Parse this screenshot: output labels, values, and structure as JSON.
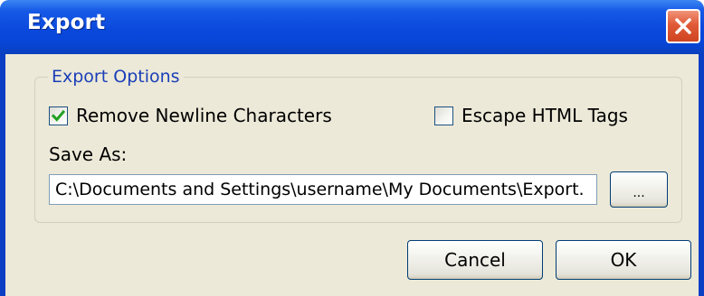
{
  "window": {
    "title": "Export"
  },
  "export_options": {
    "legend": "Export Options",
    "remove_newline": {
      "label": "Remove Newline Characters",
      "checked": true
    },
    "escape_html": {
      "label": "Escape HTML Tags",
      "checked": false
    },
    "save_as_label": "Save As:",
    "save_path": "C:\\Documents and Settings\\username\\My Documents\\Export.",
    "browse_label": "..."
  },
  "buttons": {
    "cancel": "Cancel",
    "ok": "OK"
  },
  "colors": {
    "titlebar": "#0a48dc",
    "dialog_face": "#ece9d8",
    "legend_text": "#1a3fb8",
    "checkmark": "#21a121",
    "close_button": "#e05a37"
  },
  "icons": {
    "close": "close-icon",
    "checkmark": "checkmark-icon"
  }
}
